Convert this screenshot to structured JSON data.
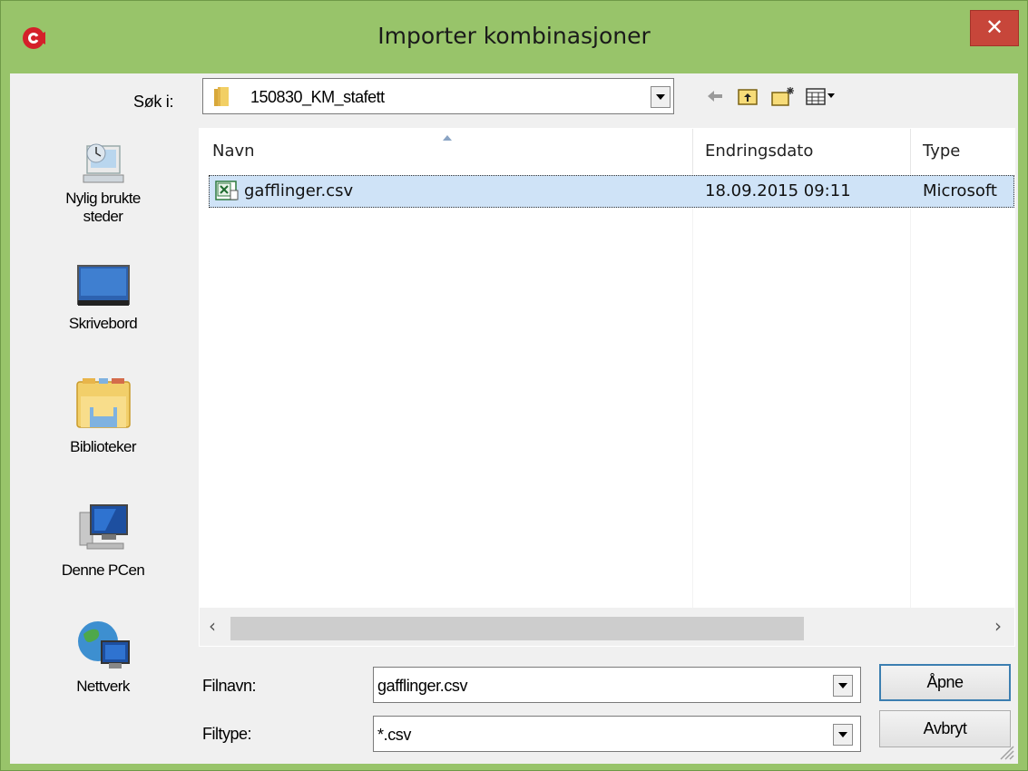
{
  "window": {
    "title": "Importer kombinasjoner",
    "close_label": "✕",
    "accent_color": "#98c46a",
    "close_color": "#c7463a"
  },
  "lookin": {
    "label": "Søk i:",
    "value": "150830_KM_stafett"
  },
  "toolbar": {
    "icons": [
      "back-arrow-icon",
      "up-folder-icon",
      "new-folder-icon",
      "view-menu-icon"
    ]
  },
  "places": [
    {
      "label_line1": "Nylig brukte",
      "label_line2": "steder",
      "icon": "recent-places-icon"
    },
    {
      "label_line1": "Skrivebord",
      "label_line2": "",
      "icon": "desktop-icon"
    },
    {
      "label_line1": "Biblioteker",
      "label_line2": "",
      "icon": "libraries-icon"
    },
    {
      "label_line1": "Denne PCen",
      "label_line2": "",
      "icon": "computer-icon"
    },
    {
      "label_line1": "Nettverk",
      "label_line2": "",
      "icon": "network-icon"
    }
  ],
  "list": {
    "columns": [
      "Navn",
      "Endringsdato",
      "Type"
    ],
    "rows": [
      {
        "name": "gafflinger.csv",
        "date": "18.09.2015 09:11",
        "type": "Microsoft",
        "icon": "excel-csv-icon",
        "selected": true
      }
    ]
  },
  "bottom": {
    "filename_label": "Filnavn:",
    "filename_value": "gafflinger.csv",
    "filetype_label": "Filtype:",
    "filetype_value": "*.csv",
    "open_label": "Åpne",
    "cancel_label": "Avbryt"
  }
}
